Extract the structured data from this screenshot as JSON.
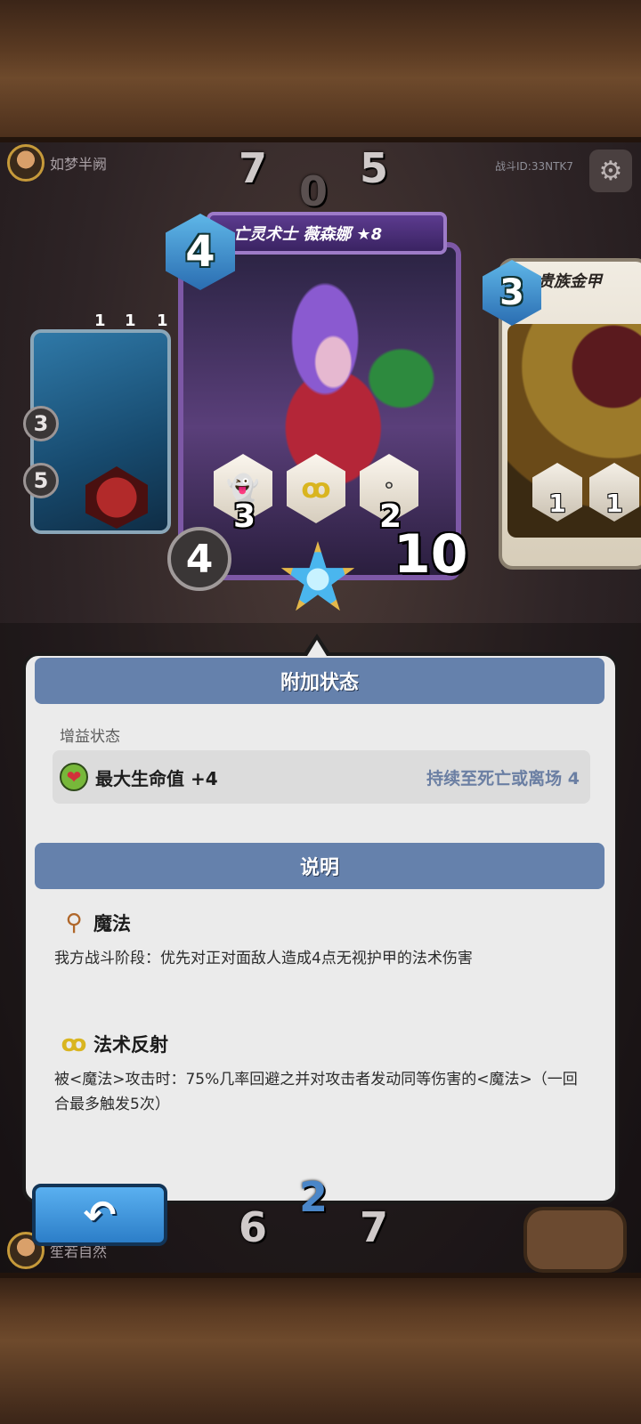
{
  "top_player": {
    "name": "如梦半阙"
  },
  "bottom_player": {
    "name": "笙若自然"
  },
  "battle_id": "战斗ID:33NTK7",
  "board": {
    "top_left_value": "7",
    "top_right_value": "5",
    "top_center_value": "0",
    "bottom_left_value": "6",
    "bottom_right_value": "7",
    "bottom_center_value": "2"
  },
  "left_card": {
    "small_stats": [
      "1",
      "1",
      "1"
    ],
    "heal_value": "3",
    "magic_value": "5",
    "side_value": "3"
  },
  "main_card": {
    "name": "亡灵术士 薇森娜 ★8",
    "mana": "4",
    "attack": "4",
    "hp": "10",
    "abilities": [
      {
        "icon": "ghost-icon",
        "value": "3"
      },
      {
        "icon": "spell-reflect-icon",
        "value": ""
      },
      {
        "icon": "fangs-icon",
        "value": "2"
      }
    ]
  },
  "right_card": {
    "name": "贵族金甲",
    "mana": "3",
    "abilities": [
      {
        "value": "1"
      },
      {
        "value": "1"
      }
    ]
  },
  "popup": {
    "status_header": "附加状态",
    "buff_section_label": "增益状态",
    "buff": {
      "name": "最大生命值 +4",
      "duration": "持续至死亡或离场 4"
    },
    "description_header": "说明",
    "abilities": [
      {
        "title": "魔法",
        "description": "我方战斗阶段：优先对正对面敌人造成4点无视护甲的法术伤害"
      },
      {
        "title": "法术反射",
        "description": "被<魔法>攻击时：75%几率回避之并对攻击者发动同等伤害的<魔法>（一回合最多触发5次）"
      }
    ]
  },
  "colors": {
    "header_blue": "#6581ac",
    "duration_text": "#6b7fa3",
    "popup_bg": "#ebebeb",
    "back_button": "#3b8fd8"
  }
}
